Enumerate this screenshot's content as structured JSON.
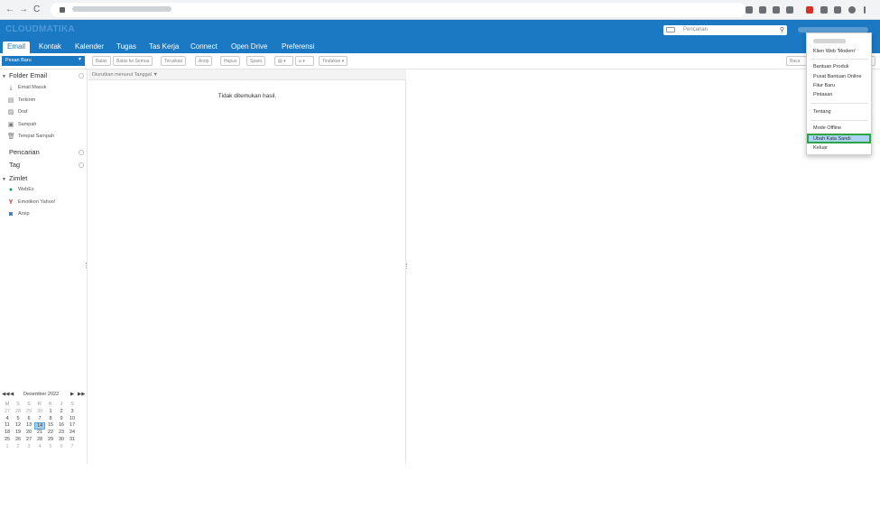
{
  "browser": {
    "back_icon": "←",
    "forward_icon": "→",
    "reload_icon": "C"
  },
  "header": {
    "logo_text": "CLOUDMATIKA",
    "search_placeholder": "Pencarian"
  },
  "tabs": [
    {
      "label": "Email",
      "active": true
    },
    {
      "label": "Kontak"
    },
    {
      "label": "Kalender"
    },
    {
      "label": "Tugas"
    },
    {
      "label": "Tas Kerja"
    },
    {
      "label": "Connect"
    },
    {
      "label": "Open Drive"
    },
    {
      "label": "Preferensi"
    }
  ],
  "toolbar": {
    "new_message": "Pesan Baru",
    "buttons": [
      "Balas",
      "Balas ke Semua",
      "Teruskan",
      "Arsip",
      "Hapus",
      "Spam",
      "Tindakan"
    ],
    "view_label": "Baca"
  },
  "sidebar": {
    "folders_label": "Folder Email",
    "folders": [
      "Email Masuk",
      "Terkirim",
      "Draf",
      "Sampah",
      "Tempat Sampah"
    ],
    "searches_label": "Pencarian",
    "tags_label": "Tag",
    "zimlets_label": "Zimlet",
    "zimlets": [
      "WebEx",
      "Emotikon Yahoo!",
      "Arsip"
    ]
  },
  "calendar": {
    "month_label": "Desember 2022",
    "day_headers": [
      "M",
      "S",
      "S",
      "R",
      "K",
      "J",
      "S"
    ],
    "weeks": [
      [
        "27",
        "28",
        "29",
        "30",
        "1",
        "2",
        "3"
      ],
      [
        "4",
        "5",
        "6",
        "7",
        "8",
        "9",
        "10"
      ],
      [
        "11",
        "12",
        "13",
        "14",
        "15",
        "16",
        "17"
      ],
      [
        "18",
        "19",
        "20",
        "21",
        "22",
        "23",
        "24"
      ],
      [
        "25",
        "26",
        "27",
        "28",
        "29",
        "30",
        "31"
      ],
      [
        "1",
        "2",
        "3",
        "4",
        "5",
        "6",
        "7"
      ]
    ],
    "today": "14"
  },
  "list": {
    "sort_label": "Diurutkan menurut Tanggal",
    "empty_message": "Tidak ditemukan hasil."
  },
  "user_menu": {
    "items": [
      "Klien Web 'Modern'",
      "Bantuan Produk",
      "Pusat Bantuan Online",
      "Fitur Baru",
      "Pintasan",
      "Tentang",
      "Mode Offline",
      "Ubah Kata Sandi",
      "Keluar"
    ],
    "highlighted": "Ubah Kata Sandi"
  },
  "colors": {
    "brand_blue": "#1b78c3",
    "highlight_border": "#2da344",
    "highlight_fill": "#a9d3f0"
  }
}
